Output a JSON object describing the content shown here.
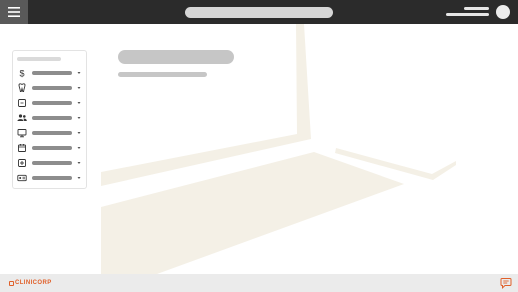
{
  "header": {
    "menu_icon": "hamburger-menu-icon",
    "user_icon": "user-avatar-icon"
  },
  "sidebar": {
    "items": [
      {
        "icon": "dollar-icon"
      },
      {
        "icon": "tooth-icon"
      },
      {
        "icon": "square-icon"
      },
      {
        "icon": "users-icon"
      },
      {
        "icon": "monitor-icon"
      },
      {
        "icon": "calendar-icon"
      },
      {
        "icon": "plus-square-icon"
      },
      {
        "icon": "id-card-icon"
      }
    ]
  },
  "footer": {
    "logo_text": "CLINICORP",
    "chat_icon": "chat-icon"
  },
  "colors": {
    "topbar": "#2b2b2b",
    "menu_button": "#595959",
    "accent": "#e0602a",
    "background_art": "#f4f0e6",
    "footer": "#ebebeb"
  }
}
